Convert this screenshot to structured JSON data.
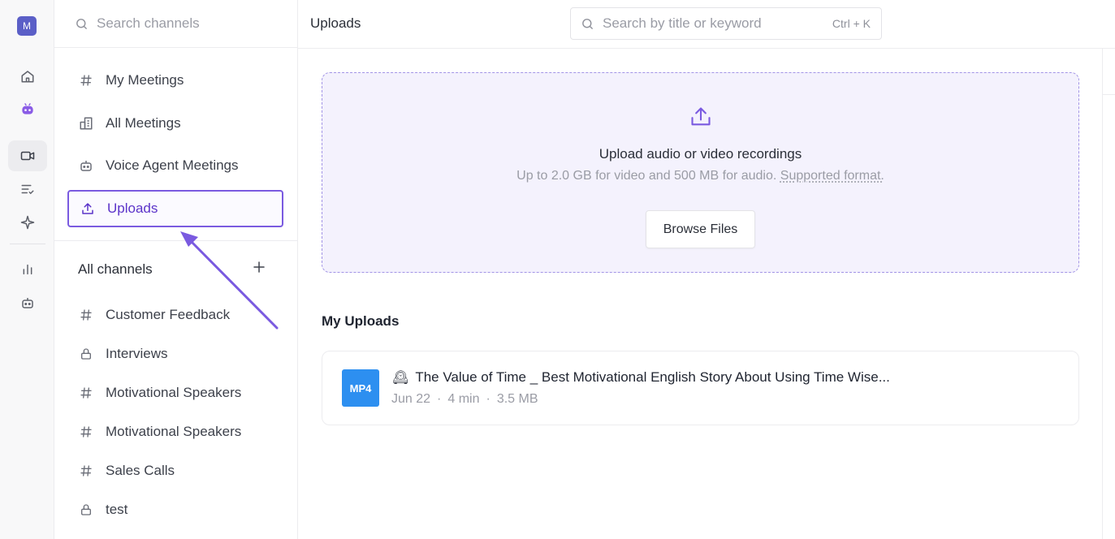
{
  "rail": {
    "avatar_letter": "M"
  },
  "sidebar": {
    "search_placeholder": "Search channels",
    "nav": [
      {
        "label": "My Meetings",
        "icon": "hash-icon"
      },
      {
        "label": "All Meetings",
        "icon": "building-icon"
      },
      {
        "label": "Voice Agent Meetings",
        "icon": "bot-icon"
      },
      {
        "label": "Uploads",
        "icon": "upload-icon",
        "selected": true
      }
    ],
    "channels_header": "All channels",
    "channels": [
      {
        "label": "Customer Feedback",
        "icon": "hash-icon"
      },
      {
        "label": "Interviews",
        "icon": "lock-icon"
      },
      {
        "label": "Motivational Speakers",
        "icon": "hash-icon"
      },
      {
        "label": "Motivational Speakers",
        "icon": "hash-icon"
      },
      {
        "label": "Sales Calls",
        "icon": "hash-icon"
      },
      {
        "label": "test",
        "icon": "lock-icon"
      }
    ]
  },
  "header": {
    "title": "Uploads",
    "search_placeholder": "Search by title or keyword",
    "shortcut": "Ctrl + K"
  },
  "dropzone": {
    "heading": "Upload audio or video recordings",
    "subtext": "Up to 2.0 GB for video and 500 MB for audio.",
    "format_link": "Supported format.",
    "browse_label": "Browse Files"
  },
  "uploads": {
    "heading": "My Uploads",
    "items": [
      {
        "badge": "MP4",
        "emoji": "🕰",
        "title": "The Value of Time _ Best Motivational English Story About Using Time Wise...",
        "date": "Jun 22",
        "duration": "4 min",
        "size": "3.5 MB"
      }
    ]
  },
  "colors": {
    "accent": "#5b33c9",
    "selection_border": "#7a5ae0",
    "dropzone_bg": "#f4f2fd",
    "badge_blue": "#2d8ff0"
  }
}
